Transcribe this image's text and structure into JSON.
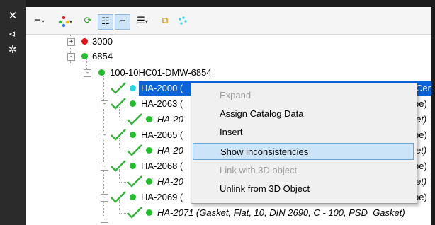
{
  "rail_icons": [
    "close-icon",
    "pin-icon",
    "settings-icon"
  ],
  "toolbar": {
    "buttons": [
      "filter-link-icon",
      "color-dots-icon",
      "refresh-icon",
      "tree-view-icon",
      "flat-view-icon",
      "add-column-icon",
      "group-icon",
      "scatter-dots-icon"
    ],
    "active": [
      "tree-view-icon",
      "flat-view-icon"
    ]
  },
  "tree": {
    "nodes": [
      {
        "label": "3000",
        "status": "red",
        "expander": "+",
        "checked": false,
        "italic": false
      },
      {
        "label": "6854",
        "status": "green",
        "expander": "-",
        "checked": false,
        "italic": false
      },
      {
        "label": "100-10HC01-DMW-6854",
        "status": "green",
        "expander": "-",
        "checked": false,
        "italic": false
      },
      {
        "label": "HA-2000 (",
        "status": "cyan",
        "expander": "",
        "checked": true,
        "italic": false,
        "selected": true,
        "tail": "Cen"
      },
      {
        "label": "HA-2063 (",
        "status": "green",
        "expander": "-",
        "checked": true,
        "italic": false,
        "tail": "pe)"
      },
      {
        "label": "HA-20",
        "status": "green",
        "expander": "",
        "checked": true,
        "italic": true,
        "tail": "et)"
      },
      {
        "label": "HA-2065 (",
        "status": "green",
        "expander": "-",
        "checked": true,
        "italic": false,
        "tail": "pe)"
      },
      {
        "label": "HA-20",
        "status": "green",
        "expander": "",
        "checked": true,
        "italic": true,
        "tail": "et)"
      },
      {
        "label": "HA-2068 (",
        "status": "green",
        "expander": "-",
        "checked": true,
        "italic": false,
        "tail": "pe)"
      },
      {
        "label": "HA-20",
        "status": "green",
        "expander": "",
        "checked": true,
        "italic": true,
        "tail": "et)"
      },
      {
        "label": "HA-2069 (",
        "status": "green",
        "expander": "-",
        "checked": true,
        "italic": false,
        "tail": "pe)"
      },
      {
        "label": "HA-2071 (Gasket, Flat, 10, DIN 2690, C - 100, PSD_Gasket)",
        "status": "green",
        "expander": "",
        "checked": true,
        "italic": true
      }
    ]
  },
  "context_menu": {
    "items": [
      {
        "label": "Expand",
        "enabled": false,
        "highlighted": false
      },
      {
        "label": "Assign Catalog Data",
        "enabled": true,
        "highlighted": false
      },
      {
        "label": "Insert",
        "enabled": true,
        "highlighted": false
      },
      {
        "label": "Show inconsistencies",
        "enabled": true,
        "highlighted": true
      },
      {
        "label": "Link with 3D object",
        "enabled": false,
        "highlighted": false
      },
      {
        "label": "Unlink from 3D Object",
        "enabled": true,
        "highlighted": false
      }
    ]
  },
  "colors": {
    "selection": "#0a64d8",
    "status_red": "#e8101a",
    "status_green": "#1fc02a",
    "status_cyan": "#2ad6e2",
    "check_green": "#35b43a",
    "menu_highlight": "#cce4f7"
  }
}
